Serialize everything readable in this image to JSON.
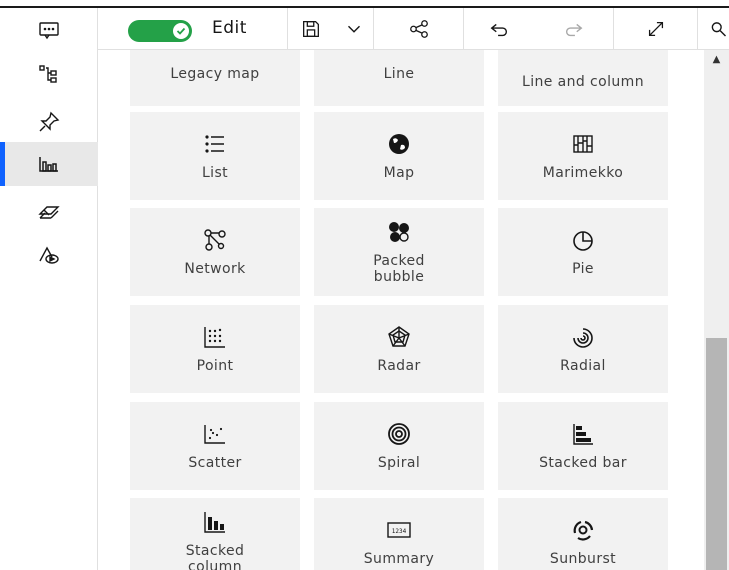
{
  "toolbar": {
    "edit_label": "Edit",
    "edit_toggle_on": true,
    "accent_color": "#24a148"
  },
  "rail": {
    "items": [
      {
        "icon": "chat-icon"
      },
      {
        "icon": "data-tree-icon"
      },
      {
        "icon": "pin-icon"
      },
      {
        "icon": "visualizations-icon",
        "active": true
      },
      {
        "icon": "layers-icon"
      },
      {
        "icon": "shapes-icon"
      }
    ],
    "active_color": "#0f62fe"
  },
  "visualizations": {
    "row0": [
      "Legacy map",
      "Line",
      "Line and column"
    ],
    "row1": [
      "List",
      "Map",
      "Marimekko"
    ],
    "row2": [
      "Network",
      "Packed bubble",
      "Pie"
    ],
    "row3": [
      "Point",
      "Radar",
      "Radial"
    ],
    "row4": [
      "Scatter",
      "Spiral",
      "Stacked bar"
    ],
    "row5": [
      "Stacked column",
      "Summary",
      "Sunburst"
    ],
    "summary_icon_text": "1234"
  }
}
